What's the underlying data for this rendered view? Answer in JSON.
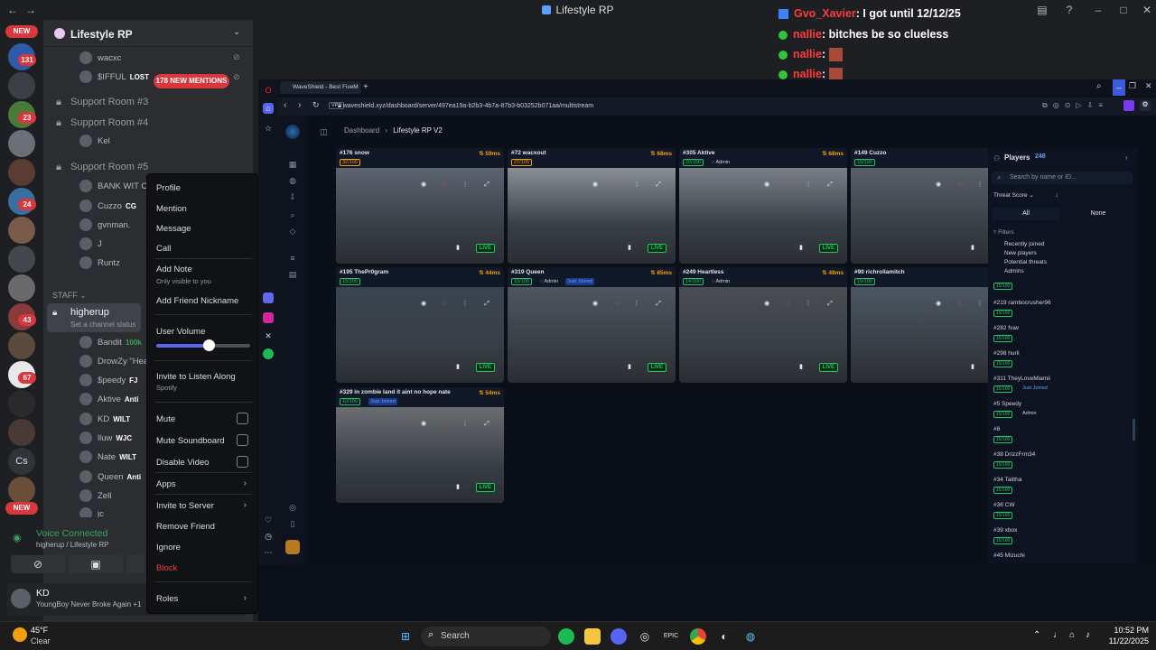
{
  "window": {
    "title": "Lifestyle RP"
  },
  "guilds": {
    "new_top": "NEW",
    "new_bottom": "NEW",
    "badges": [
      "131",
      "23",
      "24",
      "43",
      "67"
    ],
    "cs_label": "Cs"
  },
  "server": {
    "name": "Lifestyle RP",
    "mentions": "178 NEW MENTIONS",
    "top_users": [
      {
        "name": "wacxc",
        "tag": ""
      },
      {
        "name": "$IFFUL",
        "tag": "LOST"
      }
    ],
    "channels": [
      {
        "name": "Support Room #3"
      },
      {
        "name": "Support Room #4",
        "users": [
          "Kel"
        ]
      },
      {
        "name": "Support Room #5",
        "users": [
          "BANK WIT CHIE",
          "Cuzzo",
          "gvnman.",
          "J",
          "Runtz"
        ]
      }
    ],
    "cuzzo_tag": "CG",
    "category_staff": "STAFF",
    "active_channel": "higherup",
    "active_channel_status": "Set a channel status",
    "active_users": [
      {
        "name": "Bandit",
        "tag": "100k"
      },
      {
        "name": "DrowZy \"Heartl",
        "tag": ""
      },
      {
        "name": "$peedy",
        "tag": "FJ"
      },
      {
        "name": "Aktive",
        "tag": "Anti"
      },
      {
        "name": "KD",
        "tag": "WILT"
      },
      {
        "name": "lluw",
        "tag": "WJC"
      },
      {
        "name": "Nate",
        "tag": "WILT"
      },
      {
        "name": "Queen",
        "tag": "Anti"
      },
      {
        "name": "Zell",
        "tag": ""
      },
      {
        "name": "jc",
        "tag": ""
      }
    ]
  },
  "voice": {
    "status": "Voice Connected",
    "channel": "higherup / Lifestyle RP"
  },
  "userbar": {
    "name": "KD",
    "status": "YoungBoy Never Broke Again +1"
  },
  "context_menu": {
    "profile": "Profile",
    "mention": "Mention",
    "message": "Message",
    "call": "Call",
    "add_note": "Add Note",
    "add_note_sub": "Only visible to you",
    "add_nickname": "Add Friend Nickname",
    "user_volume": "User Volume",
    "user_volume_level": 0.56,
    "invite_listen": "Invite to Listen Along",
    "invite_listen_sub": "Spotify",
    "mute": "Mute",
    "mute_soundboard": "Mute Soundboard",
    "disable_video": "Disable Video",
    "apps": "Apps",
    "invite_server": "Invite to Server",
    "remove_friend": "Remove Friend",
    "ignore": "Ignore",
    "block": "Block",
    "roles": "Roles"
  },
  "chat": [
    {
      "name": "Gvo_Xavier",
      "text": ": I got until 12/12/25"
    },
    {
      "name": "nallie",
      "text": ": bitches be so clueless"
    },
    {
      "name": "nallie",
      "text": ":"
    },
    {
      "name": "nallie",
      "text": ":"
    },
    {
      "name": "nallie",
      "text": ":"
    },
    {
      "name": "nallie",
      "text": ":"
    }
  ],
  "browser": {
    "tab_title": "WaveShield - Best FiveM",
    "url": "waveshield.xyz/dashboard/server/497ea19a-b2b3-4b7a-87b3-b03252b071aa/multistream",
    "vpn": "VPN"
  },
  "dashboard": {
    "breadcrumb_root": "Dashboard",
    "breadcrumb_sep": "›",
    "breadcrumb_current": "Lifestyle RP V2",
    "live_label": "LIVE",
    "feeds": [
      {
        "title": "#176 snow",
        "ping": "59ms",
        "count": "32/100",
        "badge": "",
        "joined": ""
      },
      {
        "title": "#72 wacxout",
        "ping": "68ms",
        "count": "27/100",
        "badge": "",
        "joined": ""
      },
      {
        "title": "#305 Aktive",
        "ping": "68ms",
        "count": "20/100",
        "badge": "Admin",
        "joined": ""
      },
      {
        "title": "#149 Cuzzo",
        "ping": "152ms",
        "count": "15/100",
        "badge": "",
        "joined": ""
      },
      {
        "title": "#195 ThePr0gram",
        "ping": "44ms",
        "count": "15/100",
        "badge": "",
        "joined": ""
      },
      {
        "title": "#319 Queen",
        "ping": "85ms",
        "count": "15/100",
        "badge": "Admin",
        "joined": "Just Joined"
      },
      {
        "title": "#249 Heartless",
        "ping": "48ms",
        "count": "14/100",
        "badge": "Admin",
        "joined": ""
      },
      {
        "title": "#90 richrollamitch",
        "ping": "25ms",
        "count": "15/100",
        "badge": "",
        "joined": ""
      },
      {
        "title": "#329 in zombie land it aint no hope nate",
        "ping": "54ms",
        "count": "10/100",
        "badge": "",
        "joined": "Just Joined"
      }
    ]
  },
  "players_panel": {
    "title": "Players",
    "count": "248",
    "search_placeholder": "Search by name or ID...",
    "sort_label": "Threat Score",
    "filter_all": "All",
    "filter_none": "None",
    "filters_label": "Filters",
    "filter_items": [
      "Recently joined",
      "New players",
      "Potential threats",
      "Admins"
    ],
    "first_count": "15/100",
    "players": [
      {
        "name": "#219 rambocrusher96",
        "count": "15/100",
        "badge": ""
      },
      {
        "name": "#282 fvav",
        "count": "15/100",
        "badge": ""
      },
      {
        "name": "#298 hurli",
        "count": "15/100",
        "badge": ""
      },
      {
        "name": "#311 TheyLoveMiamii",
        "count": "15/100",
        "badge": "Just Joined"
      },
      {
        "name": "#5 Speedy",
        "count": "15/100",
        "badge": "Admin"
      },
      {
        "name": "#8",
        "count": "15/100",
        "badge": ""
      },
      {
        "name": "#38 DrizzFrm34",
        "count": "15/100",
        "badge": ""
      },
      {
        "name": "#34 Talitha",
        "count": "15/100",
        "badge": ""
      },
      {
        "name": "#36 CW",
        "count": "15/100",
        "badge": ""
      },
      {
        "name": "#39 xbox",
        "count": "15/100",
        "badge": ""
      },
      {
        "name": "#45 Mizuchi",
        "count": "",
        "badge": ""
      }
    ]
  },
  "taskbar": {
    "weather_temp": "45°F",
    "weather_desc": "Clear",
    "search": "Search",
    "time": "10:52 PM",
    "date": "11/22/2025"
  }
}
